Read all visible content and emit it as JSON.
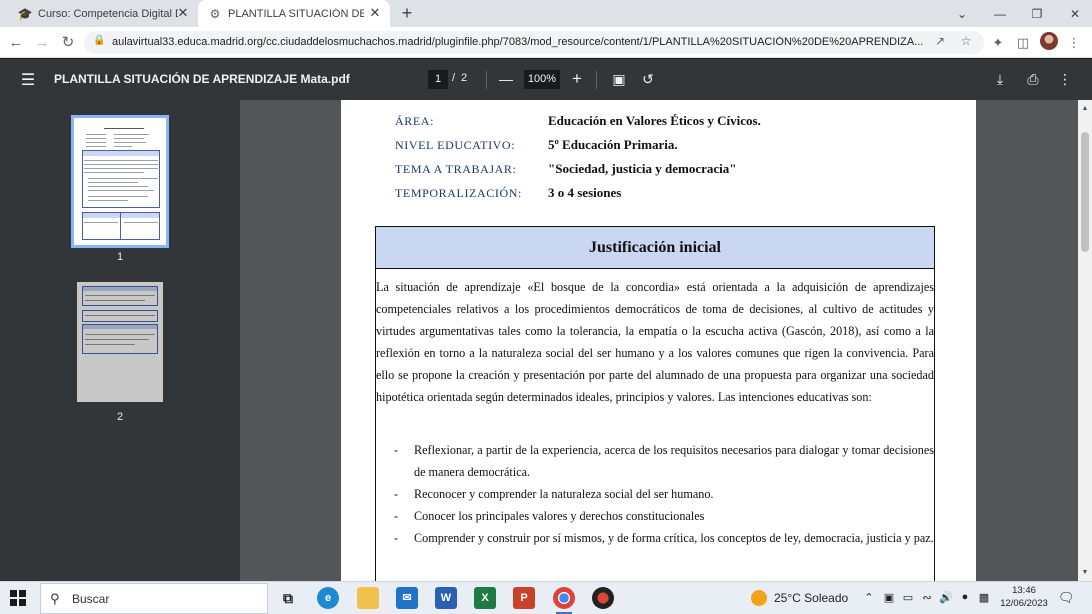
{
  "browser": {
    "tabs": [
      {
        "title": "Curso: Competencia Digital Doce",
        "icon": "graduation-cap-icon"
      },
      {
        "title": "PLANTILLA SITUACIÓN DE APREN",
        "icon": "chrome-pdf-icon"
      }
    ],
    "new_tab": "+",
    "url": "aulavirtual33.educa.madrid.org/cc.ciudaddelosmuchachos.madrid/pluginfile.php/7083/mod_resource/content/1/PLANTILLA%20SITUACIÓN%20DE%20APRENDIZA..."
  },
  "pdf_viewer": {
    "filename": "PLANTILLA SITUACIÓN DE APRENDIZAJE Mata.pdf",
    "current_page": "1",
    "page_separator": "/",
    "total_pages": "2",
    "zoom": "100%",
    "thumbnails": [
      {
        "label": "1"
      },
      {
        "label": "2"
      }
    ]
  },
  "document": {
    "fields": [
      {
        "label": "ÁREA:",
        "value": "Educación en Valores Éticos y Cívicos."
      },
      {
        "label": "NIVEL EDUCATIVO:",
        "value": "5º Educación Primaria."
      },
      {
        "label": "TEMA A TRABAJAR:",
        "value": "\"Sociedad, justicia y democracia\""
      },
      {
        "label": "TEMPORALIZACIÓN:",
        "value": "3 o 4 sesiones"
      }
    ],
    "section_title": "Justificación inicial",
    "paragraph": "La situación de aprendizaje «El bosque de la concordia» está orientada a la adquisición de aprendizajes competenciales relativos a los procedimientos democráticos de toma de decisiones, al cultivo de actitudes y virtudes argumentativas tales como la tolerancia, la empatía o la escucha activa (Gascón, 2018), así como a la reflexión en torno a la naturaleza social del ser humano y a los valores comunes que rigen la convivencia. Para ello se propone la creación y presentación por parte del alumnado de una propuesta para organizar una sociedad hipotética orientada según determinados ideales, principios y valores. Las intenciones educativas son:",
    "bullets": [
      "Reflexionar, a partir de la experiencia, acerca de los requisitos necesarios para dialogar y tomar decisiones de manera democrática.",
      "Reconocer y comprender la naturaleza social del ser humano.",
      "Conocer los principales valores y derechos constitucionales",
      "Comprender y construir por sí mismos, y de forma crítica, los conceptos de ley, democracia, justicia y paz."
    ],
    "bullet_marker": "-"
  },
  "taskbar": {
    "search_placeholder": "Buscar",
    "weather": "25°C  Soleado",
    "time": "13:46",
    "date": "12/06/2023"
  },
  "colors": {
    "header_fill": "#c9d7f3",
    "label_color": "#1f3864",
    "viewer_bg": "#525659",
    "toolbar_bg": "#323639"
  }
}
